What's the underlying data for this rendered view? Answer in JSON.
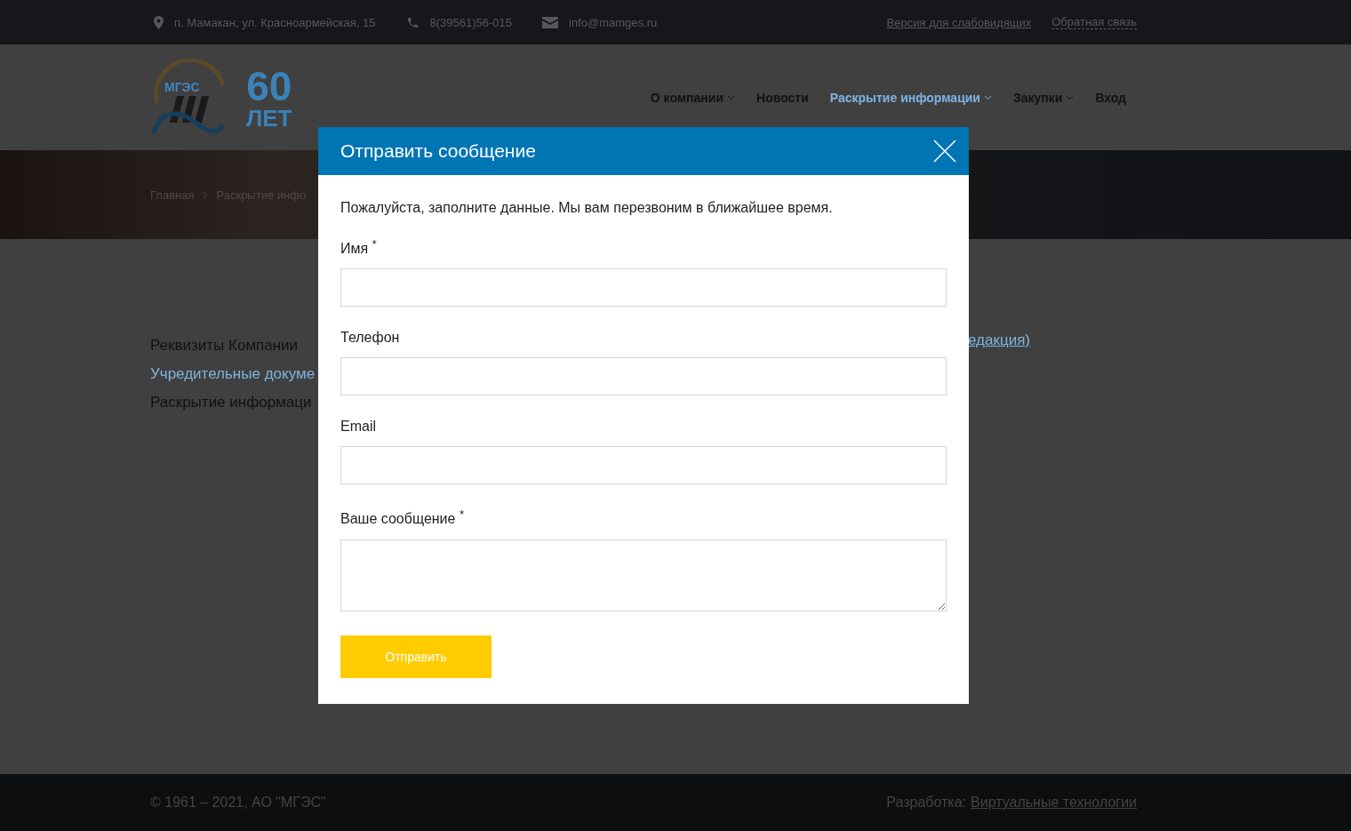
{
  "topbar": {
    "contacts": [
      {
        "kind": "address",
        "text": "п. Мамакан, ул. Красноармейская, 15"
      },
      {
        "kind": "phone",
        "text": "8(39561)56-015"
      },
      {
        "kind": "email",
        "text": "info@mamges.ru"
      }
    ],
    "links": [
      {
        "kind": "underline",
        "text": "Версия для слабовидящих"
      },
      {
        "kind": "dotted",
        "text": "Обратная связь"
      }
    ]
  },
  "logo": {
    "emblem_text": "МГЭС",
    "years": "60",
    "years_word": "ЛЕТ"
  },
  "nav": [
    {
      "label": "О компании",
      "dropdown": true,
      "selected": false
    },
    {
      "label": "Новости",
      "dropdown": false,
      "selected": false
    },
    {
      "label": "Раскрытие информации",
      "dropdown": true,
      "selected": true
    },
    {
      "label": "Закупки",
      "dropdown": true,
      "selected": false
    },
    {
      "label": "Вход",
      "dropdown": false,
      "selected": false
    }
  ],
  "breadcrumbs": [
    "Главная",
    "Раскрытие инфо"
  ],
  "content": {
    "left": [
      {
        "kind": "text",
        "text": "Реквизиты Компании"
      },
      {
        "kind": "link",
        "text": "Учредительные докуме"
      },
      {
        "kind": "text",
        "text": "Раскрытие информаци"
      }
    ],
    "right_link": "едакция)"
  },
  "modal": {
    "title": "Отправить сообщение",
    "intro": "Пожалуйста, заполните данные. Мы вам перезвоним в ближайшее время.",
    "fields": [
      {
        "kind": "text",
        "label": "Имя $^{*}$"
      },
      {
        "kind": "text",
        "label": "Телефон"
      },
      {
        "kind": "text",
        "label": "Email"
      },
      {
        "kind": "textarea",
        "label": "Ваше сообщение $^{*}$"
      }
    ],
    "submit": "Отправить"
  },
  "footer": {
    "copyright": "© 1961 – 2021, АО \"МГЭС\"",
    "dev_label": "Разработка:",
    "dev_link": "Виртуальные технологии"
  }
}
